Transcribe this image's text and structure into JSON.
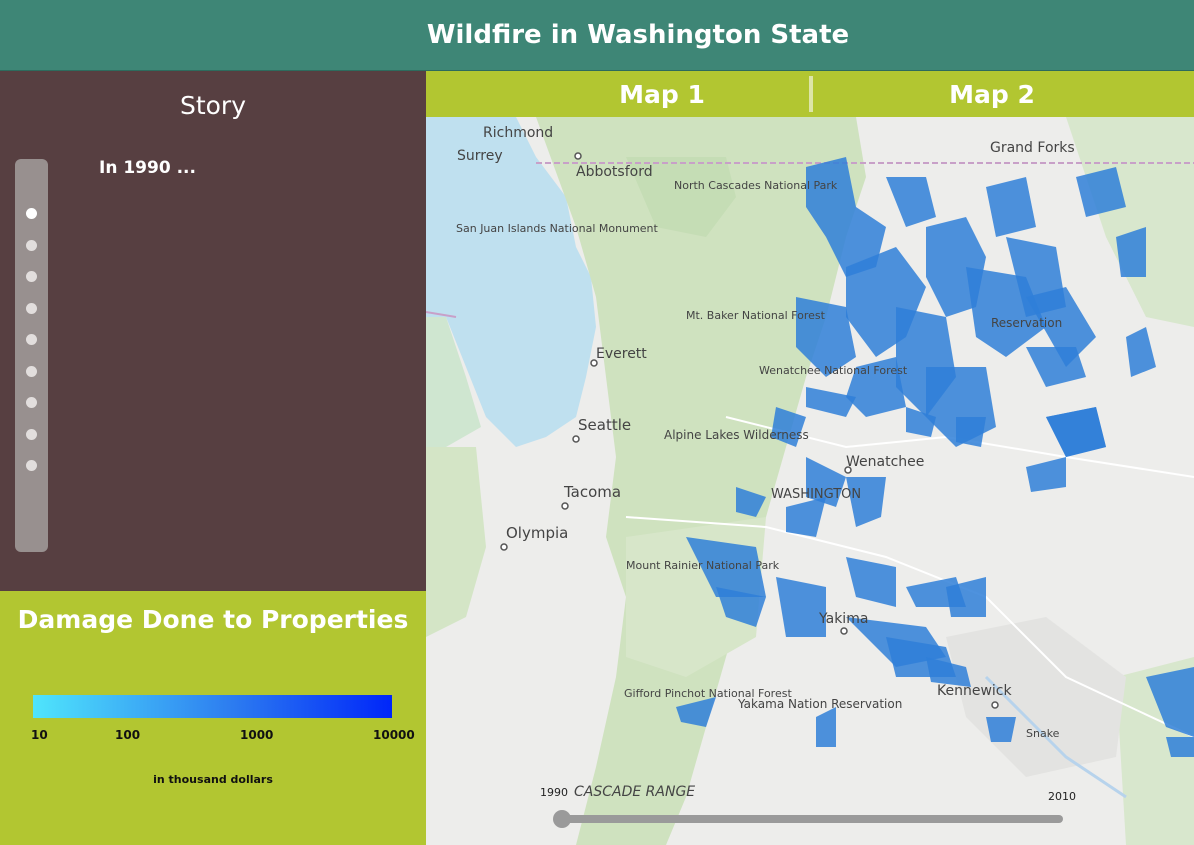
{
  "header": {
    "title": "Wildfire in Washington State"
  },
  "story": {
    "title": "Story",
    "text": "In 1990 ...",
    "nav_dots": 9,
    "active_dot": 0
  },
  "legend": {
    "title": "Damage Done to Properties",
    "ticks": [
      "10",
      "100",
      "1000",
      "10000"
    ],
    "unit": "in thousand dollars",
    "gradient_colors": [
      "#4fe5fc",
      "#2d7df0",
      "#0026f9"
    ]
  },
  "tabs": [
    {
      "label": "Map 1"
    },
    {
      "label": "Map 2"
    }
  ],
  "map": {
    "labels": {
      "richmond": "Richmond",
      "surrey": "Surrey",
      "abbotsford": "Abbotsford",
      "grand_forks": "Grand Forks",
      "north_cascades": "North Cascades National Park",
      "san_juan": "San Juan Islands National Monument",
      "mt_baker": "Mt. Baker National Forest",
      "everett": "Everett",
      "seattle": "Seattle",
      "alpine_lakes": "Alpine Lakes Wilderness",
      "wenatchee_nf": "Wenatchee National Forest",
      "wenatchee": "Wenatchee",
      "washington": "WASHINGTON",
      "tacoma": "Tacoma",
      "olympia": "Olympia",
      "mount_rainier": "Mount Rainier National Park",
      "yakima": "Yakima",
      "yakama": "Yakama Nation Reservation",
      "kennewick": "Kennewick",
      "gifford": "Gifford Pinchot National Forest",
      "cascade": "CASCADE RANGE",
      "reservation": "Reservation",
      "snake": "Snake"
    },
    "fire_color": "#2f7fd8"
  },
  "slider": {
    "start": "1990",
    "end": "2010",
    "value": "1990"
  }
}
